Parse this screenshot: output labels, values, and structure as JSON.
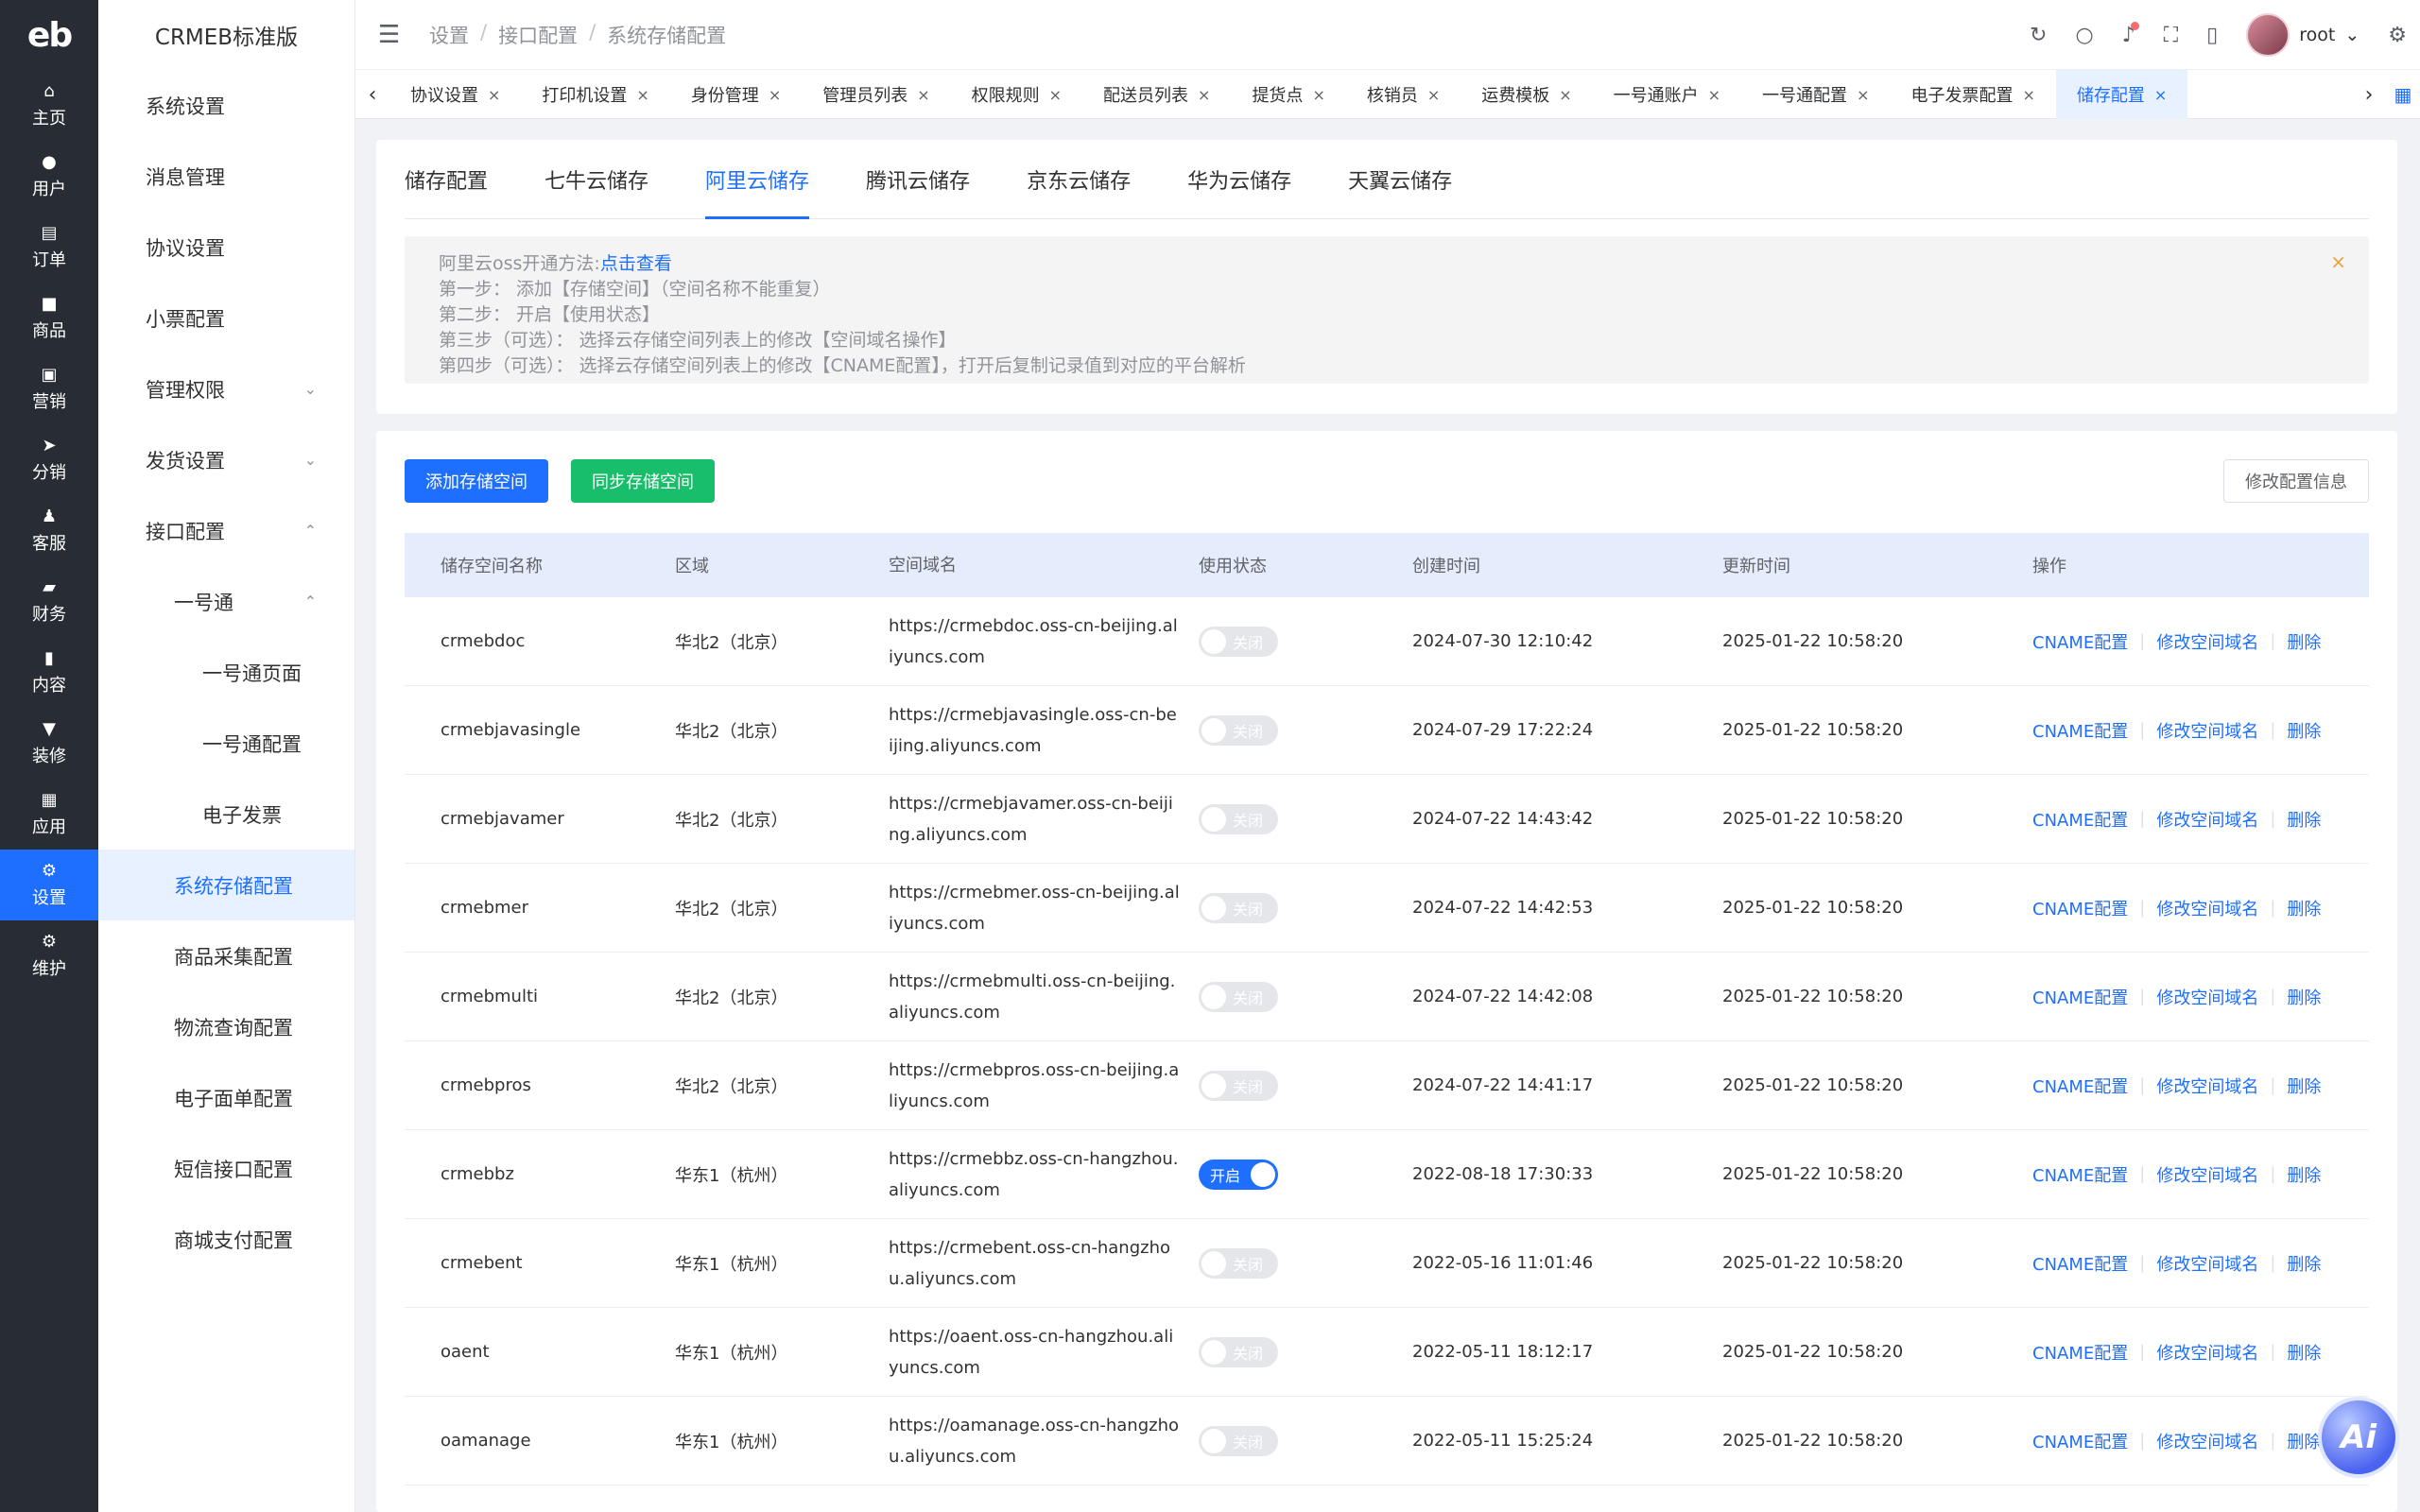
{
  "rail": {
    "logo": "eb",
    "items": [
      {
        "label": "主页",
        "icon": "home-icon",
        "glyph": "⌂",
        "active": false
      },
      {
        "label": "用户",
        "icon": "user-icon",
        "glyph": "●",
        "active": false
      },
      {
        "label": "订单",
        "icon": "order-icon",
        "glyph": "▤",
        "active": false
      },
      {
        "label": "商品",
        "icon": "goods-icon",
        "glyph": "■",
        "active": false
      },
      {
        "label": "营销",
        "icon": "marketing-icon",
        "glyph": "▣",
        "active": false
      },
      {
        "label": "分销",
        "icon": "distribution-icon",
        "glyph": "➤",
        "active": false
      },
      {
        "label": "客服",
        "icon": "service-icon",
        "glyph": "♟",
        "active": false
      },
      {
        "label": "财务",
        "icon": "finance-icon",
        "glyph": "▰",
        "active": false
      },
      {
        "label": "内容",
        "icon": "content-icon",
        "glyph": "▮",
        "active": false
      },
      {
        "label": "装修",
        "icon": "decorate-icon",
        "glyph": "▼",
        "active": false
      },
      {
        "label": "应用",
        "icon": "apps-icon",
        "glyph": "▦",
        "active": false
      },
      {
        "label": "设置",
        "icon": "settings-icon",
        "glyph": "⚙",
        "active": true
      },
      {
        "label": "维护",
        "icon": "maintain-icon",
        "glyph": "⚙",
        "active": false
      }
    ]
  },
  "submenu": {
    "brand": "CRMEB标准版",
    "items": [
      {
        "label": "系统设置",
        "level": 1,
        "chev": ""
      },
      {
        "label": "消息管理",
        "level": 1,
        "chev": ""
      },
      {
        "label": "协议设置",
        "level": 1,
        "chev": ""
      },
      {
        "label": "小票配置",
        "level": 1,
        "chev": ""
      },
      {
        "label": "管理权限",
        "level": 1,
        "chev": "⌄"
      },
      {
        "label": "发货设置",
        "level": 1,
        "chev": "⌄"
      },
      {
        "label": "接口配置",
        "level": 1,
        "chev": "⌃"
      },
      {
        "label": "一号通",
        "level": 2,
        "chev": "⌃"
      },
      {
        "label": "一号通页面",
        "level": 3,
        "chev": ""
      },
      {
        "label": "一号通配置",
        "level": 3,
        "chev": ""
      },
      {
        "label": "电子发票",
        "level": 3,
        "chev": ""
      },
      {
        "label": "系统存储配置",
        "level": 2,
        "chev": "",
        "active": true
      },
      {
        "label": "商品采集配置",
        "level": 2,
        "chev": ""
      },
      {
        "label": "物流查询配置",
        "level": 2,
        "chev": ""
      },
      {
        "label": "电子面单配置",
        "level": 2,
        "chev": ""
      },
      {
        "label": "短信接口配置",
        "level": 2,
        "chev": ""
      },
      {
        "label": "商城支付配置",
        "level": 2,
        "chev": ""
      }
    ]
  },
  "header": {
    "hamburger": "☰",
    "breadcrumb": [
      "设置",
      "接口配置",
      "系统存储配置"
    ],
    "breadcrumb_sep": "/",
    "icons": {
      "refresh": "↻",
      "search": "○",
      "bell": "♪",
      "fullscreen": "⛶",
      "mobile": "▯",
      "gear": "⚙"
    },
    "username": "root",
    "user_chevron": "⌄"
  },
  "tabs": {
    "left_arrow": "‹",
    "right_arrow": "›",
    "grid": "▦",
    "close": "×",
    "items": [
      {
        "label": "协议设置",
        "active": false
      },
      {
        "label": "打印机设置",
        "active": false
      },
      {
        "label": "身份管理",
        "active": false
      },
      {
        "label": "管理员列表",
        "active": false
      },
      {
        "label": "权限规则",
        "active": false
      },
      {
        "label": "配送员列表",
        "active": false
      },
      {
        "label": "提货点",
        "active": false
      },
      {
        "label": "核销员",
        "active": false
      },
      {
        "label": "运费模板",
        "active": false
      },
      {
        "label": "一号通账户",
        "active": false
      },
      {
        "label": "一号通配置",
        "active": false
      },
      {
        "label": "电子发票配置",
        "active": false
      },
      {
        "label": "储存配置",
        "active": true
      }
    ]
  },
  "storage_tabs": {
    "items": [
      {
        "label": "储存配置",
        "active": false
      },
      {
        "label": "七牛云储存",
        "active": false
      },
      {
        "label": "阿里云储存",
        "active": true
      },
      {
        "label": "腾讯云储存",
        "active": false
      },
      {
        "label": "京东云储存",
        "active": false
      },
      {
        "label": "华为云储存",
        "active": false
      },
      {
        "label": "天翼云储存",
        "active": false
      }
    ]
  },
  "alert": {
    "intro": "阿里云oss开通方法:",
    "link": "点击查看",
    "close": "×",
    "steps": [
      "第一步： 添加【存储空间】（空间名称不能重复）",
      "第二步： 开启【使用状态】",
      "第三步（可选）： 选择云存储空间列表上的修改【空间域名操作】",
      "第四步（可选）： 选择云存储空间列表上的修改【CNAME配置】，打开后复制记录值到对应的平台解析"
    ]
  },
  "actions": {
    "add": "添加存储空间",
    "sync": "同步存储空间",
    "edit": "修改配置信息"
  },
  "table": {
    "headers": [
      "储存空间名称",
      "区域",
      "空间域名",
      "使用状态",
      "创建时间",
      "更新时间",
      "操作"
    ],
    "switch_on": "开启",
    "switch_off": "关闭",
    "ops": [
      "CNAME配置",
      "修改空间域名",
      "删除"
    ],
    "rows": [
      {
        "name": "crmebdoc",
        "region": "华北2（北京）",
        "domain": "https://crmebdoc.oss-cn-beijing.aliyuncs.com",
        "on": false,
        "created": "2024-07-30 12:10:42",
        "updated": "2025-01-22 10:58:20"
      },
      {
        "name": "crmebjavasingle",
        "region": "华北2（北京）",
        "domain": "https://crmebjavasingle.oss-cn-beijing.aliyuncs.com",
        "on": false,
        "created": "2024-07-29 17:22:24",
        "updated": "2025-01-22 10:58:20"
      },
      {
        "name": "crmebjavamer",
        "region": "华北2（北京）",
        "domain": "https://crmebjavamer.oss-cn-beijing.aliyuncs.com",
        "on": false,
        "created": "2024-07-22 14:43:42",
        "updated": "2025-01-22 10:58:20"
      },
      {
        "name": "crmebmer",
        "region": "华北2（北京）",
        "domain": "https://crmebmer.oss-cn-beijing.aliyuncs.com",
        "on": false,
        "created": "2024-07-22 14:42:53",
        "updated": "2025-01-22 10:58:20"
      },
      {
        "name": "crmebmulti",
        "region": "华北2（北京）",
        "domain": "https://crmebmulti.oss-cn-beijing.aliyuncs.com",
        "on": false,
        "created": "2024-07-22 14:42:08",
        "updated": "2025-01-22 10:58:20"
      },
      {
        "name": "crmebpros",
        "region": "华北2（北京）",
        "domain": "https://crmebpros.oss-cn-beijing.aliyuncs.com",
        "on": false,
        "created": "2024-07-22 14:41:17",
        "updated": "2025-01-22 10:58:20"
      },
      {
        "name": "crmebbz",
        "region": "华东1（杭州）",
        "domain": "https://crmebbz.oss-cn-hangzhou.aliyuncs.com",
        "on": true,
        "created": "2022-08-18 17:30:33",
        "updated": "2025-01-22 10:58:20"
      },
      {
        "name": "crmebent",
        "region": "华东1（杭州）",
        "domain": "https://crmebent.oss-cn-hangzhou.aliyuncs.com",
        "on": false,
        "created": "2022-05-16 11:01:46",
        "updated": "2025-01-22 10:58:20"
      },
      {
        "name": "oaent",
        "region": "华东1（杭州）",
        "domain": "https://oaent.oss-cn-hangzhou.aliyuncs.com",
        "on": false,
        "created": "2022-05-11 18:12:17",
        "updated": "2025-01-22 10:58:20"
      },
      {
        "name": "oamanage",
        "region": "华东1（杭州）",
        "domain": "https://oamanage.oss-cn-hangzhou.aliyuncs.com",
        "on": false,
        "created": "2022-05-11 15:25:24",
        "updated": "2025-01-22 10:58:20"
      }
    ]
  },
  "ai_button": "Ai",
  "colors": {
    "primary": "#1e6fff",
    "success": "#19be6b",
    "rail_bg": "#282c34",
    "warning": "#e6a23c"
  }
}
